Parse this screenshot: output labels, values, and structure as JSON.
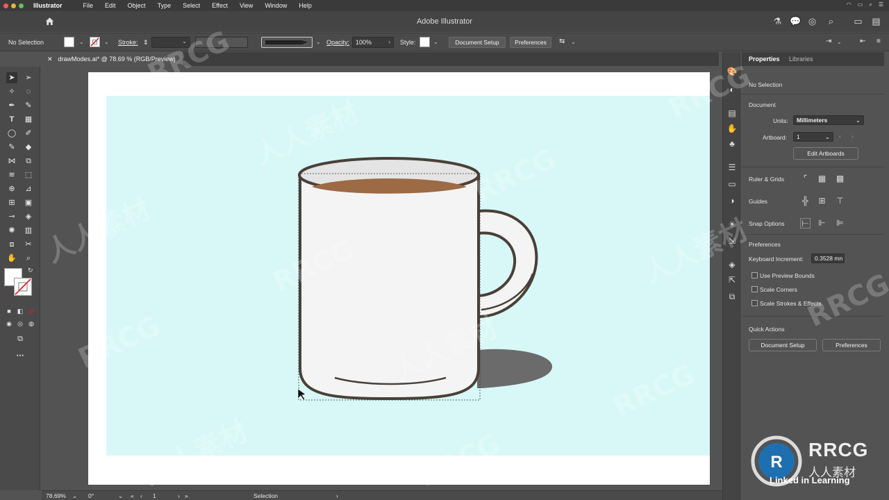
{
  "menubar": {
    "app": "Illustrator",
    "items": [
      "File",
      "Edit",
      "Object",
      "Type",
      "Select",
      "Effect",
      "View",
      "Window",
      "Help"
    ]
  },
  "appbar": {
    "title": "Adobe Illustrator"
  },
  "controlbar": {
    "selection": "No Selection",
    "stroke_label": "Stroke:",
    "opacity_label": "Opacity:",
    "opacity_value": "100%",
    "style_label": "Style:",
    "document_setup": "Document Setup",
    "preferences": "Preferences"
  },
  "document": {
    "tab_title": "drawModes.ai* @ 78.69 % (RGB/Preview)"
  },
  "properties": {
    "tabs": [
      "Properties",
      "Libraries"
    ],
    "selection": "No Selection",
    "document_heading": "Document",
    "units_label": "Units:",
    "units_value": "Millimeters",
    "artboard_label": "Artboard:",
    "artboard_value": "1",
    "edit_artboards": "Edit Artboards",
    "ruler_grids": "Ruler & Grids",
    "guides": "Guides",
    "snap_options": "Snap Options",
    "preferences_heading": "Preferences",
    "keyboard_increment_label": "Keyboard Increment:",
    "keyboard_increment_value": "0.3528 mn",
    "checkboxes": [
      "Use Preview Bounds",
      "Scale Corners",
      "Scale Strokes & Effects"
    ],
    "quick_actions": "Quick Actions",
    "qa_document_setup": "Document Setup",
    "qa_preferences": "Preferences"
  },
  "statusbar": {
    "zoom": "78.69%",
    "rotation": "0°",
    "artboard": "1",
    "tool": "Selection"
  },
  "watermark": {
    "brand": "RRCG",
    "cn": "人人素材",
    "linkedin": "Linked in Learning"
  },
  "colors": {
    "artboard_bg": "#d8f8f8",
    "mug_outline": "#4a4038",
    "coffee": "#9c6a44",
    "shadow": "#6b6b6b"
  }
}
